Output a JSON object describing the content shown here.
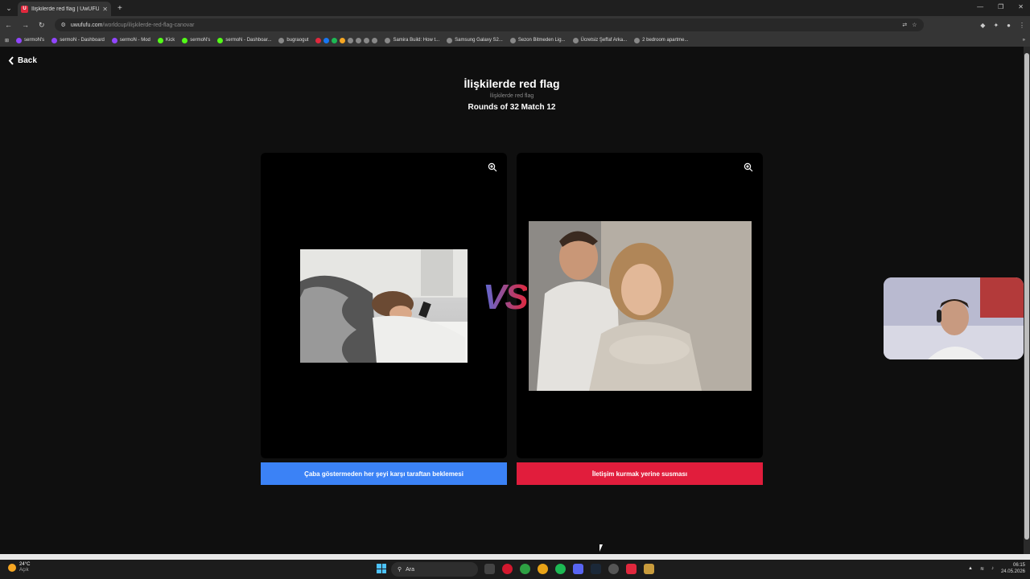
{
  "browser": {
    "tab_title": "İlişkilerde red flag | UwUFUFU",
    "favicon_letter": "U",
    "url_host": "uwufufu.com",
    "url_path": "/worldcup/ilişkilerde-red-flag-canovar",
    "bookmarks": [
      "sermoN's",
      "sermoN - Dashboard",
      "sermoN - Mod",
      "Kick",
      "sermoN's",
      "sermoN - Dashboar...",
      "bugraogut",
      "Samira Build: How t...",
      "Samsung Galaxy S2...",
      "Sezon Bitmeden Lig...",
      "Ücretsiz Şeffaf Arka...",
      "2 bedroom apartme..."
    ]
  },
  "page": {
    "back_label": "Back",
    "title": "İlişkilerde red flag",
    "subtitle": "İlişkilerde red flag",
    "round_info": "Rounds of 32 Match 12",
    "vs_label": "VS",
    "left_choice": "Çaba göstermeden her şeyi karşı taraftan beklemesi",
    "right_choice": "İletişim kurmak yerine susması",
    "colors": {
      "left_button": "#3b82f6",
      "right_button": "#e11d3c",
      "background": "#0f0f0f"
    }
  },
  "taskbar": {
    "weather_temp": "24°C",
    "weather_desc": "Açık",
    "search_placeholder": "Ara",
    "time": "06:15",
    "date": "24.05.2026"
  }
}
